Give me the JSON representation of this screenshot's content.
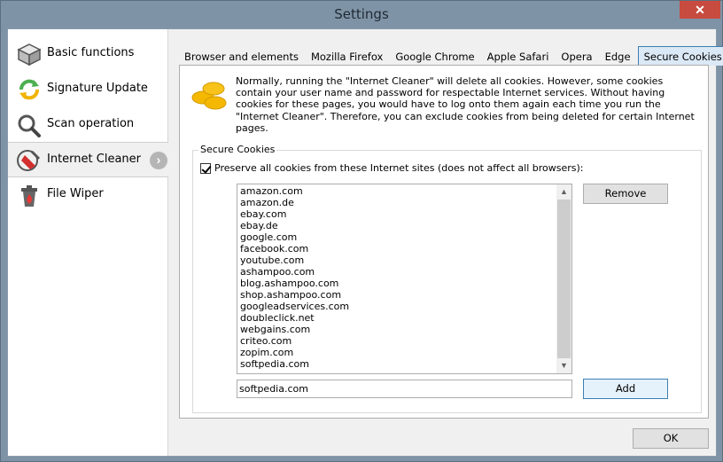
{
  "window": {
    "title": "Settings",
    "close_label": "✕"
  },
  "sidebar": {
    "items": [
      {
        "label": "Basic functions",
        "icon": "box-icon"
      },
      {
        "label": "Signature Update",
        "icon": "refresh-icon"
      },
      {
        "label": "Scan operation",
        "icon": "magnifier-icon"
      },
      {
        "label": "Internet Cleaner",
        "icon": "broom-icon",
        "active": true
      },
      {
        "label": "File Wiper",
        "icon": "trash-fire-icon"
      }
    ],
    "active_arrow": "›"
  },
  "tabs": [
    {
      "label": "Browser and elements"
    },
    {
      "label": "Mozilla Firefox"
    },
    {
      "label": "Google Chrome"
    },
    {
      "label": "Apple Safari"
    },
    {
      "label": "Opera"
    },
    {
      "label": "Edge"
    },
    {
      "label": "Secure Cookies",
      "active": true
    }
  ],
  "panel": {
    "info_text": "Normally, running the \"Internet Cleaner\" will delete all cookies. However, some cookies contain your user name and password for respectable Internet services. Without having cookies for these pages, you would have to log onto them again each time you run the \"Internet Cleaner\". Therefore, you can exclude cookies from being deleted for certain Internet pages.",
    "group_title": "Secure Cookies",
    "checkbox_label": "Preserve all cookies from these Internet sites (does not affect all browsers):",
    "checkbox_checked": true,
    "sites": [
      "amazon.com",
      "amazon.de",
      "ebay.com",
      "ebay.de",
      "google.com",
      "facebook.com",
      "youtube.com",
      "ashampoo.com",
      "blog.ashampoo.com",
      "shop.ashampoo.com",
      "googleadservices.com",
      "doubleclick.net",
      "webgains.com",
      "criteo.com",
      "zopim.com",
      "softpedia.com"
    ],
    "remove_label": "Remove",
    "input_value": "softpedia.com",
    "add_label": "Add"
  },
  "footer": {
    "ok_label": "OK"
  },
  "colors": {
    "accent": "#3c7fb1",
    "close": "#c74b3f"
  }
}
